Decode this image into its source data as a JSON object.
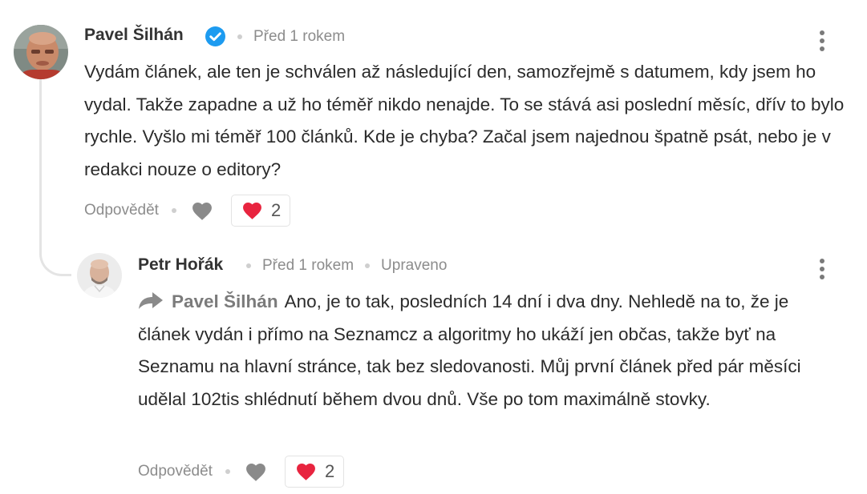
{
  "comments": [
    {
      "author": "Pavel Šilhán",
      "verified": true,
      "time": "Před 1 rokem",
      "text": "Vydám článek, ale ten je schválen až následující den, samozřejmě s datumem, kdy jsem ho vydal. Takže zapadne a už ho téměř nikdo nenajde. To se stává asi poslední měsíc, dřív to bylo rychle. Vyšlo mi téměř 100 článků. Kde je chyba? Začal jsem najednou špatně psát, nebo je v redakci nouze o editory?",
      "reply_label": "Odpovědět",
      "reaction_count": "2"
    },
    {
      "author": "Petr Hořák",
      "time": "Před 1 rokem",
      "edited": "Upraveno",
      "reply_to": "Pavel Šilhán",
      "text": "Ano, je to tak, posledních 14 dní i dva dny. Nehledě na to, že je článek vydán i přímo na Seznamcz a algoritmy ho ukáží jen občas, takže byť na Seznamu na hlavní stránce, tak bez sledovanosti. Můj první článek před pár měsíci udělal 102tis shlédnutí během dvou dnů. Vše po tom maximálně stovky.",
      "reply_label": "Odpovědět",
      "reaction_count": "2"
    }
  ],
  "icons": {
    "verified": "verified-check-icon",
    "more": "kebab-menu-icon",
    "like": "heart-outline-icon",
    "reaction": "heart-filled-icon",
    "reply_arrow": "reply-arrow-icon"
  },
  "colors": {
    "verified": "#1d9bf0",
    "reaction_heart": "#e8243f",
    "like_heart": "#8a8a8a",
    "meta_text": "#8c8c8c"
  }
}
